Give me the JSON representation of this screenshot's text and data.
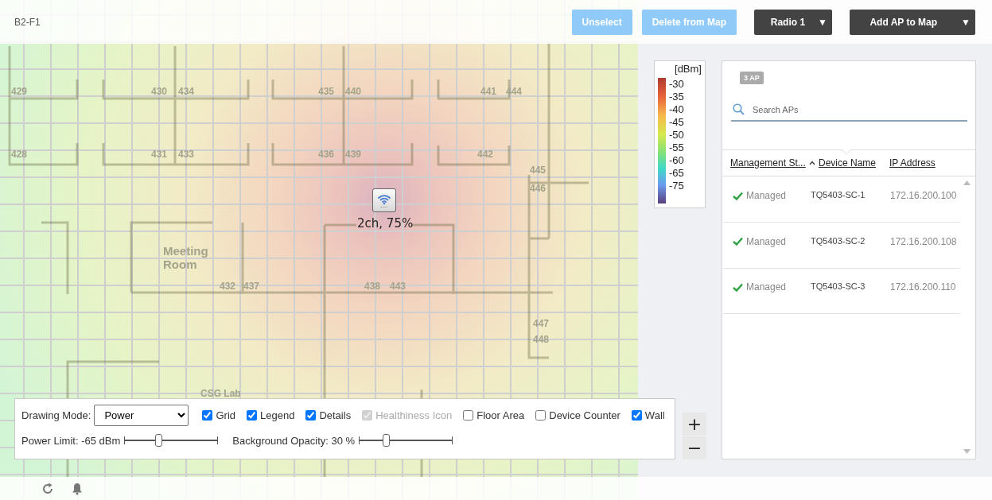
{
  "floor": "B2-F1",
  "toolbar": {
    "buttons": [
      {
        "label": "Unselect",
        "disabled": true
      },
      {
        "label": "Delete from Map",
        "disabled": true
      }
    ],
    "dropdowns": [
      {
        "label": "Radio 1",
        "caret": "▼"
      },
      {
        "label": "Add AP to Map",
        "caret": "▼"
      }
    ]
  },
  "map": {
    "rooms": [
      "429",
      "430",
      "434",
      "435",
      "440",
      "441",
      "444",
      "428",
      "431",
      "433",
      "436",
      "439",
      "442",
      "445",
      "446",
      "447",
      "448",
      "Meeting Room",
      "432",
      "437",
      "438",
      "443",
      "CSG Lab"
    ],
    "access_point": {
      "label": "2ch, 75%"
    }
  },
  "legend": {
    "unit": "[dBm]",
    "ticks": [
      "-30",
      "-35",
      "-40",
      "-45",
      "-50",
      "-55",
      "-60",
      "-65",
      "-75"
    ]
  },
  "ap_panel": {
    "count_badge": "3 AP",
    "search": {
      "placeholder": "Search APs"
    },
    "columns": [
      {
        "label": "Management St...",
        "sorted": false
      },
      {
        "label": "Device Name",
        "sorted": true
      },
      {
        "label": "IP Address",
        "sorted": false
      }
    ],
    "rows": [
      {
        "status": "Managed",
        "device_name": "TQ5403-SC-1",
        "ip": "172.16.200.100"
      },
      {
        "status": "Managed",
        "device_name": "TQ5403-SC-2",
        "ip": "172.16.200.108"
      },
      {
        "status": "Managed",
        "device_name": "TQ5403-SC-3",
        "ip": "172.16.200.110"
      }
    ]
  },
  "controls": {
    "drawing_mode": {
      "label": "Drawing Mode:",
      "value": "Power"
    },
    "options": [
      {
        "label": "Grid",
        "checked": true,
        "disabled": false
      },
      {
        "label": "Legend",
        "checked": true,
        "disabled": false
      },
      {
        "label": "Details",
        "checked": true,
        "disabled": false
      },
      {
        "label": "Healthiness Icon",
        "checked": true,
        "disabled": true
      },
      {
        "label": "Floor Area",
        "checked": false,
        "disabled": false
      },
      {
        "label": "Device Counter",
        "checked": false,
        "disabled": false
      },
      {
        "label": "Wall",
        "checked": true,
        "disabled": false
      }
    ],
    "sliders": [
      {
        "label": "Power Limit: -65 dBm",
        "level": 0.36
      },
      {
        "label": "Background Opacity: 30 %",
        "level": 0.29
      }
    ],
    "zoom": [
      "+",
      "−"
    ]
  }
}
